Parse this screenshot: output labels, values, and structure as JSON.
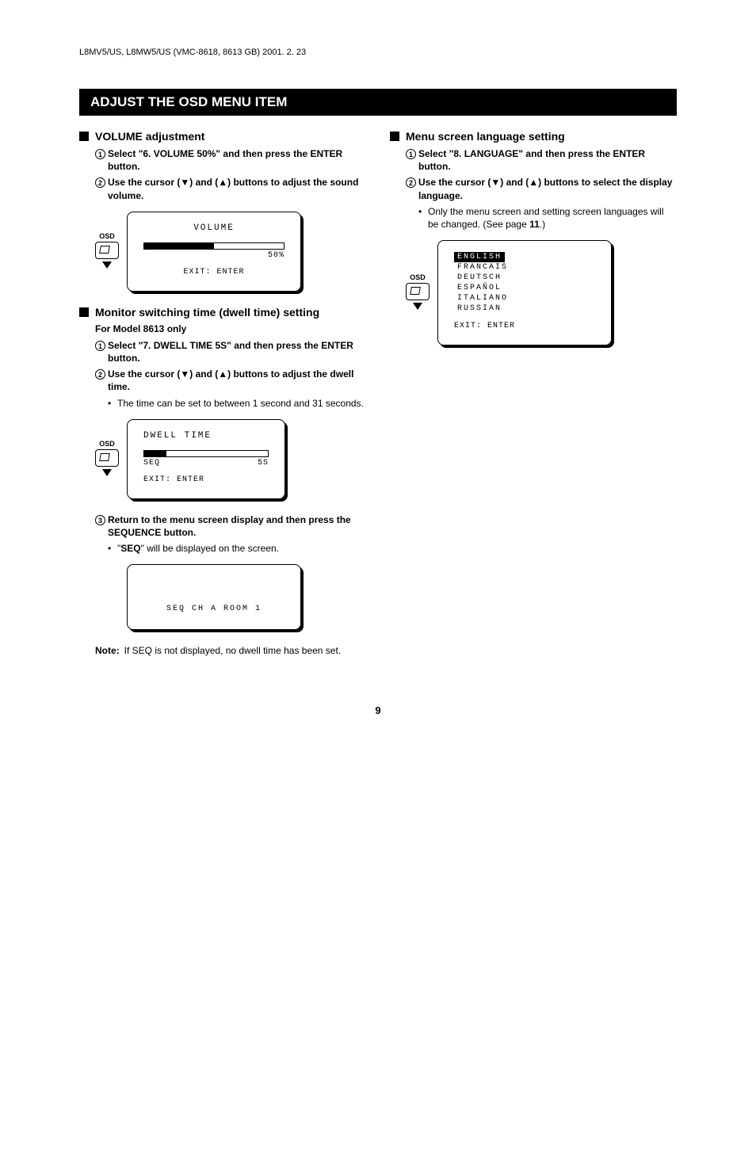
{
  "header_ref": "L8MV5/US, L8MW5/US (VMC-8618, 8613 GB) 2001. 2. 23",
  "title": "ADJUST THE OSD MENU ITEM",
  "volume": {
    "heading": "VOLUME adjustment",
    "step1": "Select \"6. VOLUME 50%\" and then press the ENTER button.",
    "step2": "Use the cursor (▼) and (▲) buttons to adjust the sound volume.",
    "osd_label": "OSD",
    "scr_title": "VOLUME",
    "scr_value": "50%",
    "scr_exit": "EXIT: ENTER"
  },
  "dwell": {
    "heading": "Monitor switching time (dwell time) setting",
    "sub": "For Model 8613 only",
    "step1": "Select \"7. DWELL TIME 5S\" and then press the ENTER button.",
    "step2": "Use the cursor (▼) and (▲) buttons to adjust the dwell time.",
    "bullet2": "The time can be set to between 1 second and 31 seconds.",
    "osd_label": "OSD",
    "scr_title": "DWELL TIME",
    "scr_left": "SEQ",
    "scr_right": "5S",
    "scr_exit": "EXIT: ENTER",
    "step3": "Return to the menu screen display and then press the SEQUENCE button.",
    "bullet3_pre": "\"",
    "bullet3_bold": "SEQ",
    "bullet3_post": "\" will be displayed on the screen.",
    "seq_text": "SEQ CH A ROOM 1",
    "note_label": "Note:",
    "note_text": "If SEQ is not displayed, no dwell time has been set."
  },
  "lang": {
    "heading": "Menu screen language setting",
    "step1": "Select \"8. LANGUAGE\" and then press the ENTER button.",
    "step2": "Use the cursor (▼) and (▲) buttons to select the display language.",
    "bullet_pre": "Only the menu screen and setting screen languages will be changed. (See page ",
    "bullet_bold": "11",
    "bullet_post": ".)",
    "osd_label": "OSD",
    "opts": [
      "ENGLISH",
      "FRANCAIS",
      "DEUTSCH",
      "ESPAÑOL",
      "ITALIANO",
      "RUSSIAN"
    ],
    "scr_exit": "EXIT: ENTER"
  },
  "page": "9"
}
